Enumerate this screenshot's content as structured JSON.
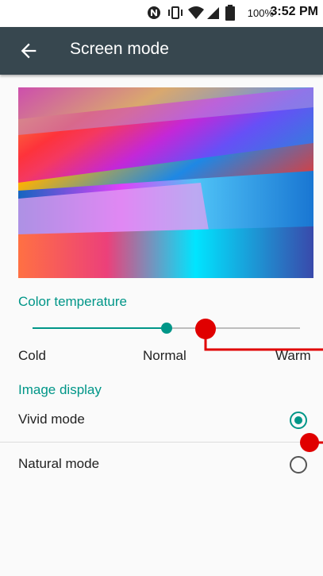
{
  "status_bar": {
    "battery_text": "100%",
    "time": "3:52 PM",
    "icons": [
      "nfc-icon",
      "vibrate-icon",
      "wifi-icon",
      "cell-signal-icon",
      "battery-icon"
    ]
  },
  "toolbar": {
    "back_icon": "arrow-back-icon",
    "title": "Screen mode"
  },
  "color_temperature": {
    "header": "Color temperature",
    "slider_value": 0.5,
    "labels": {
      "cold": "Cold",
      "normal": "Normal",
      "warm": "Warm"
    }
  },
  "image_display": {
    "header": "Image display",
    "options": [
      {
        "label": "Vivid mode",
        "selected": true
      },
      {
        "label": "Natural mode",
        "selected": false
      }
    ]
  },
  "colors": {
    "accent": "#009688",
    "toolbar": "#37474f",
    "annotation": "#e00000"
  }
}
